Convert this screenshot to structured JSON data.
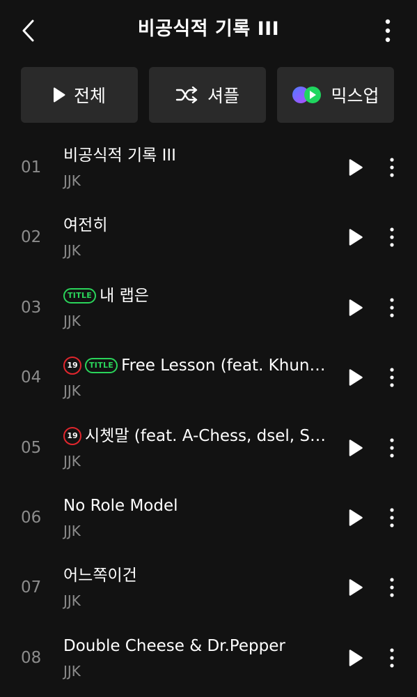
{
  "header": {
    "title": "비공식적 기록 III",
    "back_icon": "chevron-left-icon",
    "more_icon": "more-vertical-icon"
  },
  "actions": {
    "play_all_label": "전체",
    "shuffle_label": "셔플",
    "mixup_label": "믹스업"
  },
  "tracks": [
    {
      "number": "01",
      "title": "비공식적 기록 III",
      "artist": "JJK",
      "explicit": false,
      "title_track": false
    },
    {
      "number": "02",
      "title": "여전히",
      "artist": "JJK",
      "explicit": false,
      "title_track": false
    },
    {
      "number": "03",
      "title": "내 랩은",
      "artist": "JJK",
      "explicit": false,
      "title_track": true
    },
    {
      "number": "04",
      "title": "Free Lesson (feat. Khundi…",
      "artist": "JJK",
      "explicit": true,
      "title_track": true
    },
    {
      "number": "05",
      "title": "시쳇말 (feat. A-Chess, dsel, So…",
      "artist": "JJK",
      "explicit": true,
      "title_track": false
    },
    {
      "number": "06",
      "title": "No Role Model",
      "artist": "JJK",
      "explicit": false,
      "title_track": false
    },
    {
      "number": "07",
      "title": "어느쪽이건",
      "artist": "JJK",
      "explicit": false,
      "title_track": false
    },
    {
      "number": "08",
      "title": "Double Cheese & Dr.Pepper",
      "artist": "JJK",
      "explicit": false,
      "title_track": false
    }
  ],
  "badges": {
    "explicit_label": "19",
    "title_label": "TITLE"
  },
  "colors": {
    "background": "#121212",
    "button_bg": "#2a2a2a",
    "title_badge": "#2ad45a",
    "explicit_badge": "#e0262d",
    "secondary_text": "#8c8c8c"
  }
}
